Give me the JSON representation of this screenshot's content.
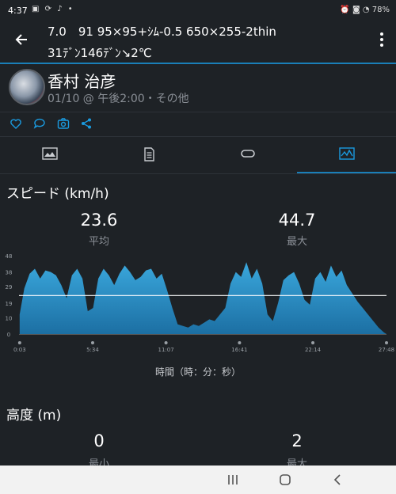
{
  "status": {
    "time": "4:37",
    "icons_left": "▣ ⟳ ♪ •",
    "right": "⏰ ◙ ◔ 78%"
  },
  "header": {
    "title": "7.0　91 95×95+ｼﾑ-0.5 650×255-2thin",
    "subtitle": "31ﾃﾞﾝ146ﾃﾞﾝ↘2℃"
  },
  "profile": {
    "name": "香村 治彦",
    "meta": "01/10 @ 午後2:00・その他"
  },
  "colors": {
    "accent": "#1a7fb8",
    "chart_fill": "#2b93c8",
    "panel": "#1e2226"
  },
  "speed": {
    "title": "スピード (km/h)",
    "avg_value": "23.6",
    "avg_label": "平均",
    "max_value": "44.7",
    "max_label": "最大"
  },
  "altitude": {
    "title": "高度 (m)",
    "min_value": "0",
    "min_label": "最小",
    "max_value": "2",
    "max_label": "最大"
  },
  "chart_data": {
    "type": "area",
    "title": "",
    "xlabel": "時間（時：分：秒）",
    "ylabel": "",
    "x_tick_labels": [
      "0:03",
      "5:34",
      "11:07",
      "16:41",
      "22:14",
      "27:48"
    ],
    "y_tick_labels": [
      "0",
      "10",
      "19",
      "29",
      "38",
      "48"
    ],
    "ylim": [
      0,
      48
    ],
    "average_line": 23.6,
    "series": [
      {
        "x_minutes": [
          0.05,
          0.4,
          0.8,
          1.2,
          1.6,
          2.0,
          2.4,
          2.8,
          3.2,
          3.6,
          4.0,
          4.4,
          4.8,
          5.2,
          5.6,
          6.0,
          6.4,
          6.8,
          7.2,
          7.6,
          8.0,
          8.4,
          8.8,
          9.2,
          9.6,
          10.0,
          10.4,
          10.8,
          11.2,
          11.6,
          12.0,
          12.4,
          12.8,
          13.2,
          13.6,
          14.0,
          14.4,
          14.8,
          15.2,
          15.6,
          16.0,
          16.4,
          16.8,
          17.2,
          17.6,
          18.0,
          18.4,
          18.8,
          19.2,
          19.6,
          20.0,
          20.4,
          20.8,
          21.2,
          21.6,
          22.0,
          22.4,
          22.8,
          23.2,
          23.6,
          24.0,
          24.4,
          24.8,
          25.2,
          25.6,
          26.0,
          26.4,
          26.8,
          27.2,
          27.6,
          27.8
        ],
        "values": [
          12,
          28,
          37,
          40,
          34,
          39,
          38,
          36,
          30,
          22,
          36,
          40,
          34,
          14,
          16,
          34,
          40,
          36,
          30,
          37,
          42,
          38,
          33,
          35,
          39,
          40,
          34,
          37,
          27,
          16,
          6,
          5,
          4,
          6,
          5,
          7,
          9,
          8,
          12,
          16,
          31,
          38,
          35,
          44,
          34,
          40,
          31,
          12,
          8,
          19,
          33,
          36,
          38,
          31,
          21,
          18,
          34,
          38,
          32,
          42,
          35,
          39,
          30,
          25,
          20,
          16,
          12,
          8,
          4,
          1,
          0
        ]
      }
    ]
  }
}
